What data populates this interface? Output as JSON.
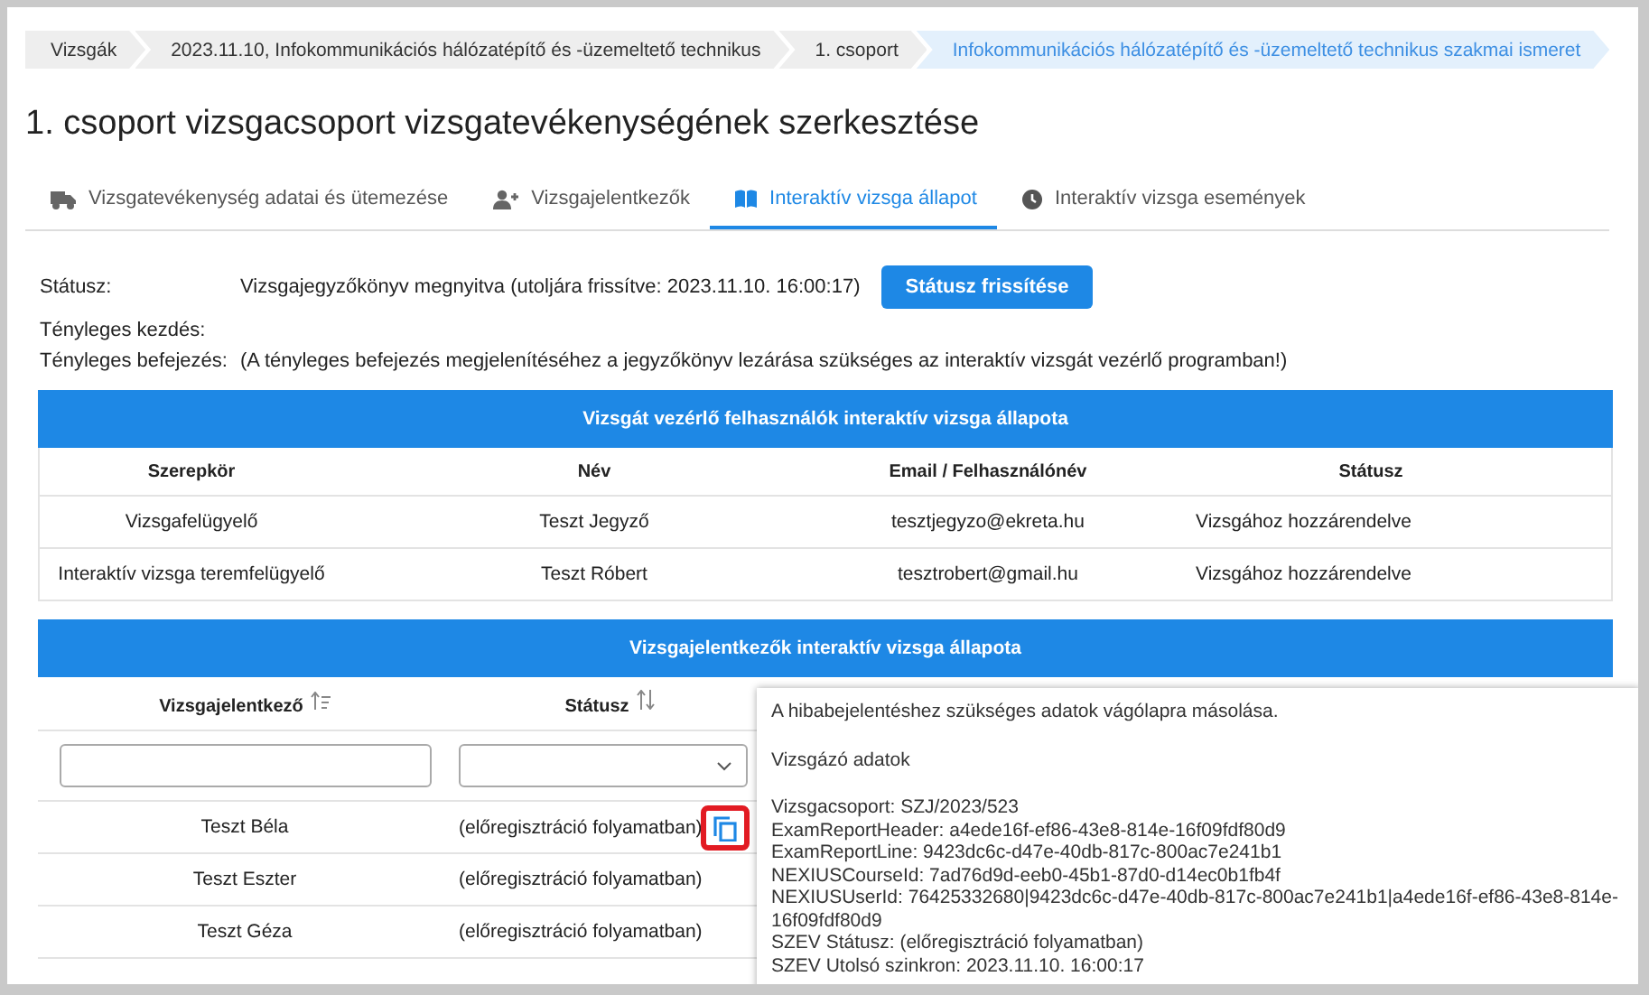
{
  "breadcrumb": [
    {
      "label": "Vizsgák",
      "selected": false
    },
    {
      "label": "2023.11.10, Infokommunikációs hálózatépítő és -üzemeltető technikus",
      "selected": false
    },
    {
      "label": "1. csoport",
      "selected": false
    },
    {
      "label": "Infokommunikációs hálózatépítő és -üzemeltető technikus szakmai ismeret",
      "selected": true
    }
  ],
  "title": "1. csoport vizsgacsoport vizsgatevékenységének szerkesztése",
  "tabs": [
    {
      "label": "Vizsgatevékenység adatai és ütemezése",
      "selected": false
    },
    {
      "label": "Vizsgajelentkezők",
      "selected": false
    },
    {
      "label": "Interaktív vizsga állapot",
      "selected": true
    },
    {
      "label": "Interaktív vizsga események",
      "selected": false
    }
  ],
  "status": {
    "rows": [
      {
        "label": "Státusz:",
        "value": "Vizsgajegyzőkönyv megnyitva  (utoljára frissítve: 2023.11.10. 16:00:17)"
      },
      {
        "label": "Tényleges kezdés:"
      },
      {
        "label": "Tényleges befejezés:",
        "value": "(A tényleges befejezés megjelenítéséhez a jegyzőkönyv lezárása szükséges az interaktív vizsgát vezérlő programban!)"
      }
    ],
    "button": "Státusz frissítése"
  },
  "users_table": {
    "title": "Vizsgát vezérlő felhasználók interaktív vizsga állapota",
    "columns": [
      "Szerepkör",
      "Név",
      "Email / Felhasználónév",
      "Státusz"
    ],
    "rows": [
      [
        "Vizsgafelügyelő",
        "Teszt Jegyző",
        "tesztjegyzo@ekreta.hu",
        "Vizsgához hozzárendelve"
      ],
      [
        "Interaktív vizsga teremfelügyelő",
        "Teszt Róbert",
        "tesztrobert@gmail.hu",
        "Vizsgához hozzárendelve"
      ]
    ]
  },
  "candidates_table": {
    "title": "Vizsgajelentkezők interaktív vizsga állapota",
    "columns": [
      {
        "label": "Vizsgajelentkező",
        "sorted": true
      },
      {
        "label": "Státusz",
        "sorted": false
      }
    ],
    "rows": [
      {
        "name": "Teszt Béla",
        "status": "(előregisztráció folyamatban)",
        "copy_highlighted": true
      },
      {
        "name": "Teszt Eszter",
        "status": "(előregisztráció folyamatban)",
        "copy_highlighted": false
      },
      {
        "name": "Teszt Géza",
        "status": "(előregisztráció folyamatban)",
        "copy_highlighted": false
      }
    ]
  },
  "tooltip": {
    "paragraphs": [
      [
        "A hibabejelentéshez szükséges adatok vágólapra másolása."
      ],
      [
        "Vizsgázó adatok"
      ],
      [
        "Vizsgacsoport: SZJ/2023/523",
        "ExamReportHeader: a4ede16f-ef86-43e8-814e-16f09fdf80d9",
        "ExamReportLine: 9423dc6c-d47e-40db-817c-800ac7e241b1",
        "NEXIUSCourseId: 7ad76d9d-eeb0-45b1-87d0-d14ec0b1fb4f",
        "NEXIUSUserId: 76425332680|9423dc6c-d47e-40db-817c-800ac7e241b1|a4ede16f-ef86-43e8-814e-16f09fdf80d9",
        "SZEV Státusz: (előregisztráció folyamatban)",
        "SZEV Utolsó szinkron: 2023.11.10. 16:00:17"
      ]
    ]
  }
}
